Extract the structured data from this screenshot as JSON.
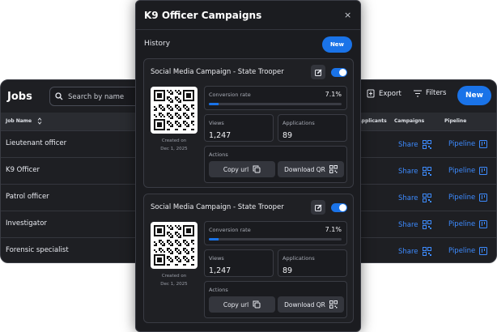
{
  "jobs": {
    "title": "Jobs",
    "search_placeholder": "Search by name",
    "export_label": "Export",
    "filters_label": "Filters",
    "new_label": "New",
    "columns": {
      "job_name": "Job Name",
      "applicants": "Applicants",
      "campaigns": "Campaigns",
      "pipeline": "Pipeline"
    },
    "rows": [
      {
        "name": "Lieutenant officer",
        "share": "Share",
        "pipeline": "Pipeline"
      },
      {
        "name": "K9 Officer",
        "share": "Share",
        "pipeline": "Pipeline"
      },
      {
        "name": "Patrol officer",
        "share": "Share",
        "pipeline": "Pipeline"
      },
      {
        "name": "Investigator",
        "share": "Share",
        "pipeline": "Pipeline"
      },
      {
        "name": "Forensic specialist",
        "share": "Share",
        "pipeline": "Pipeline"
      }
    ]
  },
  "modal": {
    "title": "K9 Officer Campaigns",
    "close": "×",
    "history_label": "History",
    "new_label": "New",
    "cards": [
      {
        "title": "Social Media Campaign - State Trooper",
        "enabled": true,
        "created_label": "Created on",
        "created_date": "Dec 1, 2025",
        "conversion_label": "Conversion rate",
        "conversion_value": "7.1%",
        "conversion_fraction": 0.071,
        "views_label": "Views",
        "views_value": "1,247",
        "applications_label": "Applications",
        "applications_value": "89",
        "actions_label": "Actions",
        "copy_label": "Copy url",
        "download_label": "Download QR"
      },
      {
        "title": "Social Media Campaign - State Trooper",
        "enabled": true,
        "created_label": "Created on",
        "created_date": "Dec 1, 2025",
        "conversion_label": "Conversion rate",
        "conversion_value": "7.1%",
        "conversion_fraction": 0.071,
        "views_label": "Views",
        "views_value": "1,247",
        "applications_label": "Applications",
        "applications_value": "89",
        "actions_label": "Actions",
        "copy_label": "Copy url",
        "download_label": "Download QR"
      }
    ]
  },
  "colors": {
    "accent": "#1a73e8",
    "link": "#3d8bff",
    "panel": "#1b1c20"
  }
}
